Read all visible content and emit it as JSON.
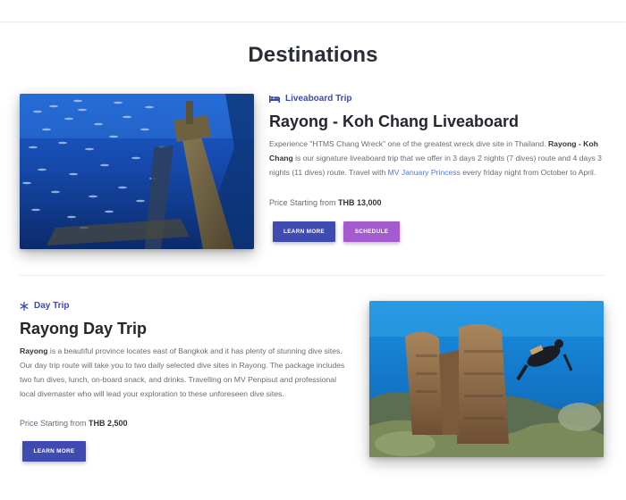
{
  "page": {
    "title": "Destinations"
  },
  "cards": [
    {
      "tag": "Liveaboard Trip",
      "tag_icon": "bed-icon",
      "title": "Rayong - Koh Chang Liveaboard",
      "description": {
        "t1": "Experience \"HTMS Chang Wreck\" one of the greatest wreck dive site in Thailand. ",
        "b1": "Rayong - Koh Chang",
        "t2": " is our signature liveaboard trip that we offer in 3 days 2 nights (7 dives) route and 4 days 3 nights (11 dives) route. Travel with ",
        "link": "MV January Princess",
        "t3": " every friday night from October to April."
      },
      "price_prefix": "Price Starting from ",
      "price_value": "THB 13,000",
      "buttons": {
        "learn_more": "LEARN MORE",
        "schedule": "SCHEDULE"
      },
      "image": "shipwreck-with-fish-school-photo"
    },
    {
      "tag": "Day Trip",
      "tag_icon": "snowflake-icon",
      "title": "Rayong Day Trip",
      "description": {
        "b1": "Rayong",
        "t1": " is a beautiful province locates east of Bangkok and it has plenty of stunning dive sites. Our day trip route will take you to two daily selected dive sites in Rayong. The package includes two fun dives, lunch, on-board snack, and drinks. Travelling on MV Penpisut and professional local divemaster who will lead your exploration to these unforeseen dive sites."
      },
      "price_prefix": "Price Starting from ",
      "price_value": "THB 2,500",
      "buttons": {
        "learn_more": "LEARN MORE"
      },
      "image": "diver-and-coral-photo"
    }
  ],
  "colors": {
    "accent": "#3f4bb1",
    "secondary": "#a55bd0",
    "link": "#4f79d6",
    "title": "#24272e"
  }
}
